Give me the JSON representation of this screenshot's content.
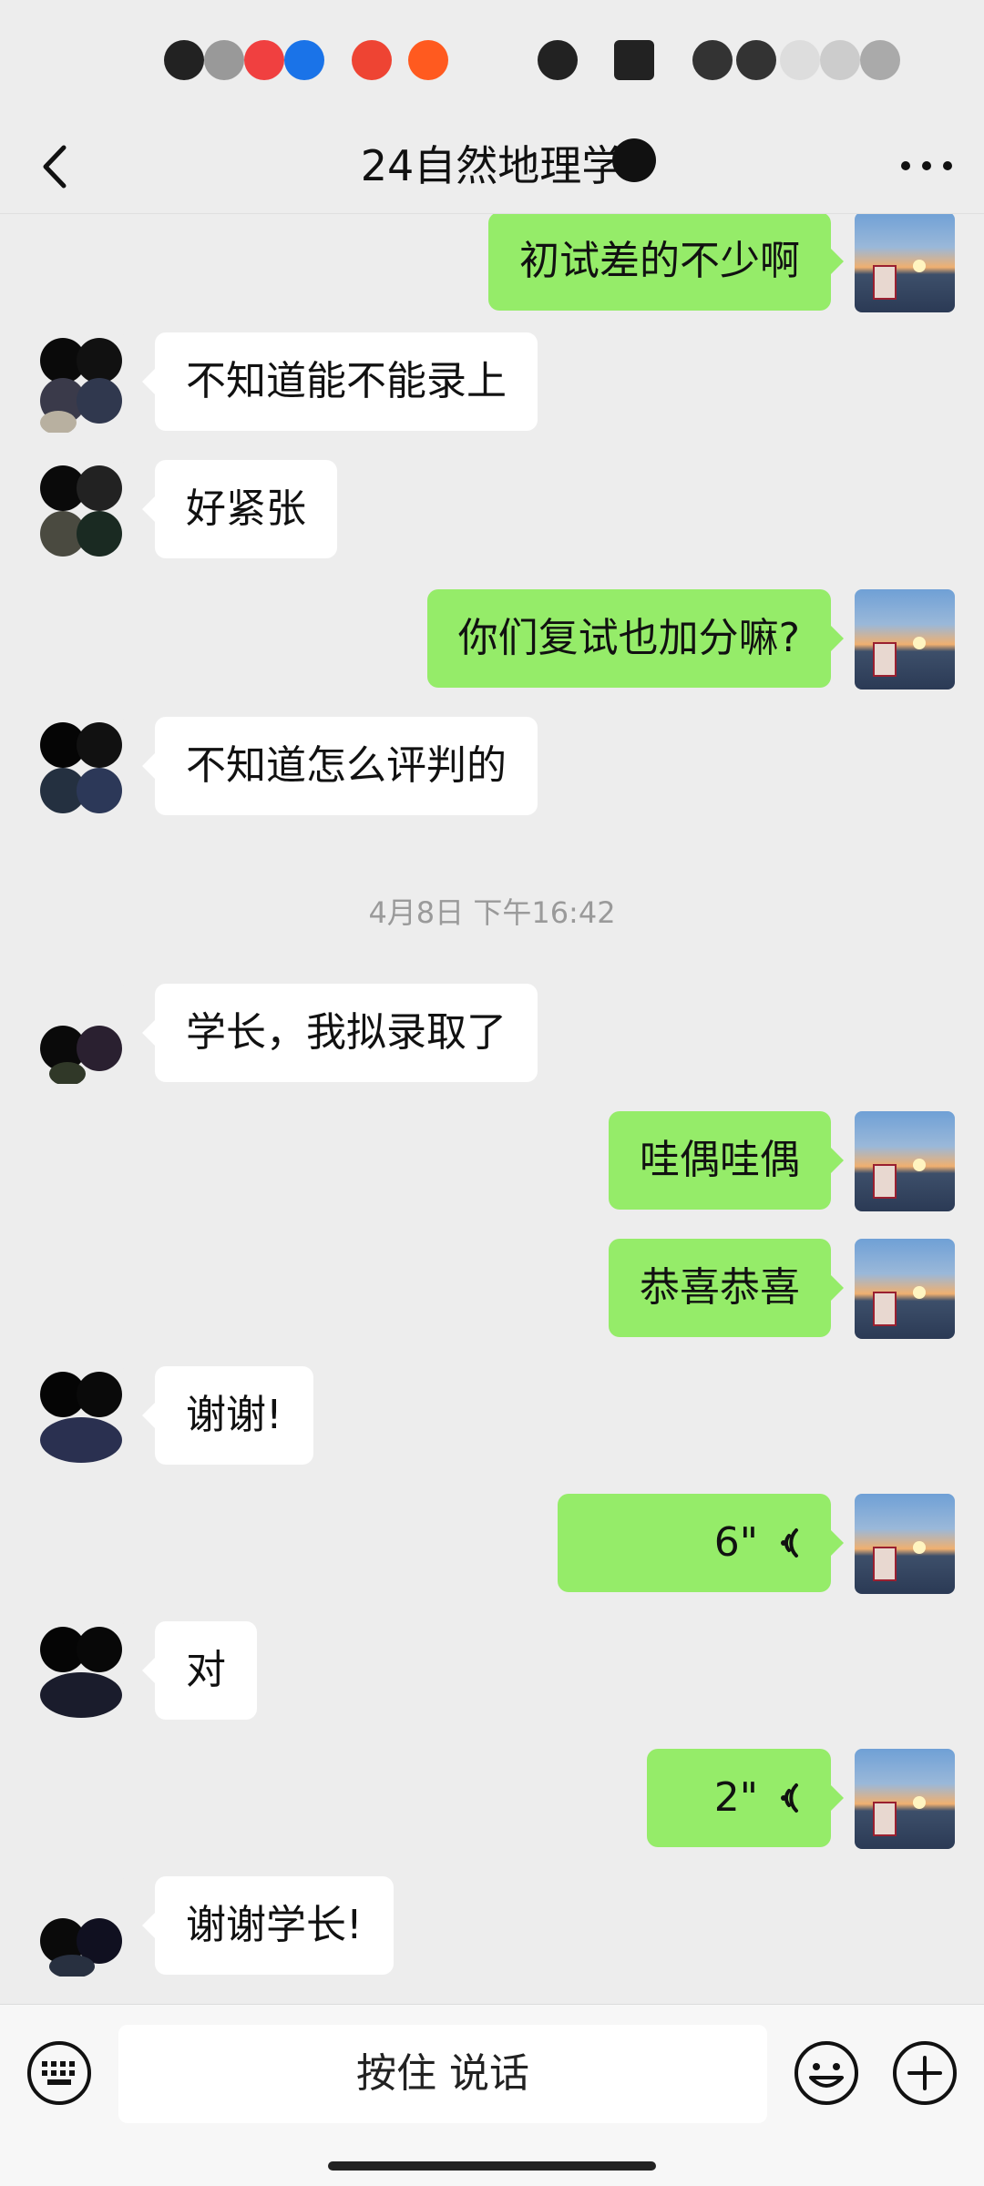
{
  "header": {
    "title": "24自然地理学"
  },
  "messages": [
    {
      "side": "out",
      "text": "初试差的不少啊"
    },
    {
      "side": "in",
      "text": "不知道能不能录上"
    },
    {
      "side": "in",
      "text": "好紧张"
    },
    {
      "side": "out",
      "text": "你们复试也加分嘛?"
    },
    {
      "side": "in",
      "text": "不知道怎么评判的"
    },
    {
      "side": "in",
      "text": "学长，我拟录取了"
    },
    {
      "side": "out",
      "text": "哇偶哇偶"
    },
    {
      "side": "out",
      "text": "恭喜恭喜"
    },
    {
      "side": "in",
      "text": "谢谢!"
    },
    {
      "side": "out",
      "voice": "6\""
    },
    {
      "side": "in",
      "text": "对"
    },
    {
      "side": "out",
      "voice": "2\""
    },
    {
      "side": "in",
      "text": "谢谢学长!"
    }
  ],
  "timestamp": "4月8日 下午16:42",
  "input_bar": {
    "talk_label": "按住 说话"
  },
  "colors": {
    "background": "#ededed",
    "outgoing_bubble": "#95ec69",
    "incoming_bubble": "#ffffff"
  }
}
